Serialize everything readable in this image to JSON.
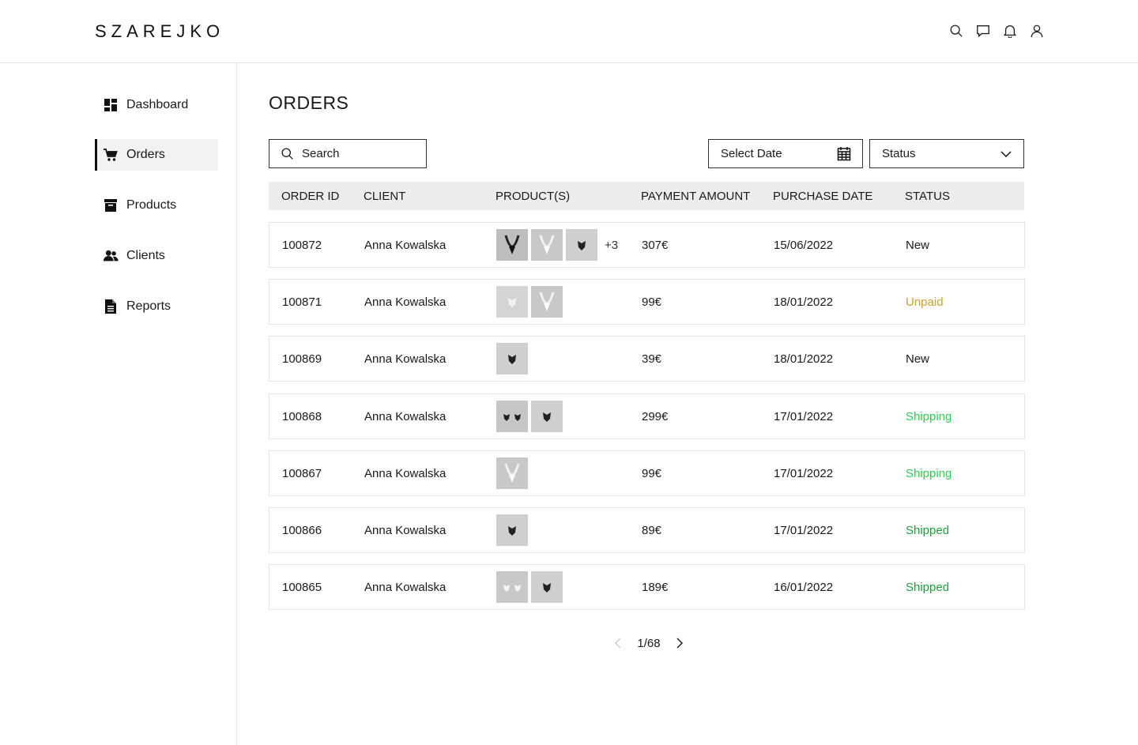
{
  "brand": {
    "logo": "SZAREJKO"
  },
  "header_icons": [
    "search-icon",
    "chat-icon",
    "bell-icon",
    "user-icon"
  ],
  "sidebar": {
    "items": [
      {
        "label": "Dashboard",
        "icon": "dashboard-icon",
        "active": false
      },
      {
        "label": "Orders",
        "icon": "cart-icon",
        "active": true
      },
      {
        "label": "Products",
        "icon": "box-icon",
        "active": false
      },
      {
        "label": "Clients",
        "icon": "users-icon",
        "active": false
      },
      {
        "label": "Reports",
        "icon": "document-icon",
        "active": false
      }
    ]
  },
  "main": {
    "title": "ORDERS",
    "search": {
      "placeholder": "Search"
    },
    "date_filter": {
      "label": "Select Date"
    },
    "status_filter": {
      "label": "Status"
    },
    "columns": [
      "ORDER ID",
      "CLIENT",
      "PRODUCT(S)",
      "PAYMENT AMOUNT",
      "PURCHASE DATE",
      "STATUS"
    ],
    "rows": [
      {
        "id": "100872",
        "client": "Anna Kowalska",
        "products": [
          "necklace-dark",
          "necklace-light",
          "ring-dark"
        ],
        "more": "+3",
        "amount": "307€",
        "date": "15/06/2022",
        "status": "New"
      },
      {
        "id": "100871",
        "client": "Anna Kowalska",
        "products": [
          "ring-light",
          "necklace-light"
        ],
        "more": "",
        "amount": "99€",
        "date": "18/01/2022",
        "status": "Unpaid"
      },
      {
        "id": "100869",
        "client": "Anna Kowalska",
        "products": [
          "ring-dark"
        ],
        "more": "",
        "amount": "39€",
        "date": "18/01/2022",
        "status": "New"
      },
      {
        "id": "100868",
        "client": "Anna Kowalska",
        "products": [
          "earrings-dark",
          "ring-dark"
        ],
        "more": "",
        "amount": "299€",
        "date": "17/01/2022",
        "status": "Shipping"
      },
      {
        "id": "100867",
        "client": "Anna Kowalska",
        "products": [
          "necklace-light"
        ],
        "more": "",
        "amount": "99€",
        "date": "17/01/2022",
        "status": "Shipping"
      },
      {
        "id": "100866",
        "client": "Anna Kowalska",
        "products": [
          "ring-dark"
        ],
        "more": "",
        "amount": "89€",
        "date": "17/01/2022",
        "status": "Shipped"
      },
      {
        "id": "100865",
        "client": "Anna Kowalska",
        "products": [
          "earrings-light",
          "ring-dark"
        ],
        "more": "",
        "amount": "189€",
        "date": "16/01/2022",
        "status": "Shipped"
      }
    ],
    "pagination": {
      "label": "1/68"
    }
  },
  "status_colors": {
    "New": "#1a1a1a",
    "Unpaid": "#c9a227",
    "Shipping": "#2ecc52",
    "Shipped": "#1f9e3a"
  }
}
